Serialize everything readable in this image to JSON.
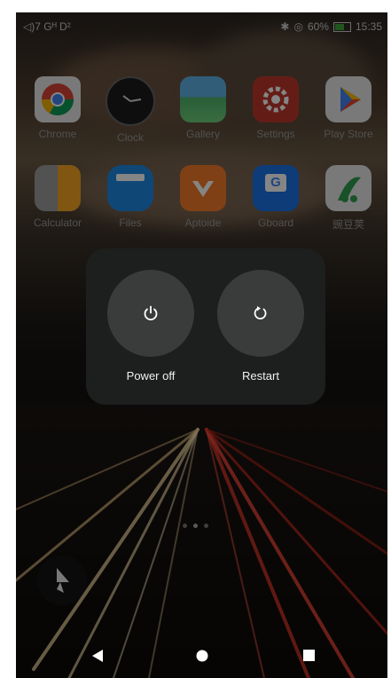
{
  "status_bar": {
    "left_text": "◁)7 Gᴴ D²",
    "battery": "60%",
    "time": "15:35",
    "icons": [
      "bluetooth-icon",
      "wifi-icon",
      "battery-icon"
    ]
  },
  "apps_row1": [
    {
      "label": "Chrome",
      "icon": "chrome-icon"
    },
    {
      "label": "Clock",
      "icon": "clock-icon"
    },
    {
      "label": "Gallery",
      "icon": "gallery-icon"
    },
    {
      "label": "Settings",
      "icon": "settings-icon"
    },
    {
      "label": "Play Store",
      "icon": "play-store-icon"
    }
  ],
  "apps_row2": [
    {
      "label": "Calculator",
      "icon": "calculator-icon"
    },
    {
      "label": "Files",
      "icon": "files-icon"
    },
    {
      "label": "Aptoide",
      "icon": "aptoide-icon"
    },
    {
      "label": "Gboard",
      "icon": "gboard-icon"
    },
    {
      "label": "豌豆荚",
      "icon": "wandoujia-icon"
    }
  ],
  "power_dialog": {
    "power_off_label": "Power off",
    "restart_label": "Restart"
  },
  "page_indicator": {
    "count": 3,
    "active": 1
  },
  "colors": {
    "dialog_bg": "#1d1f1e",
    "button_bg": "#3a3c3b"
  }
}
